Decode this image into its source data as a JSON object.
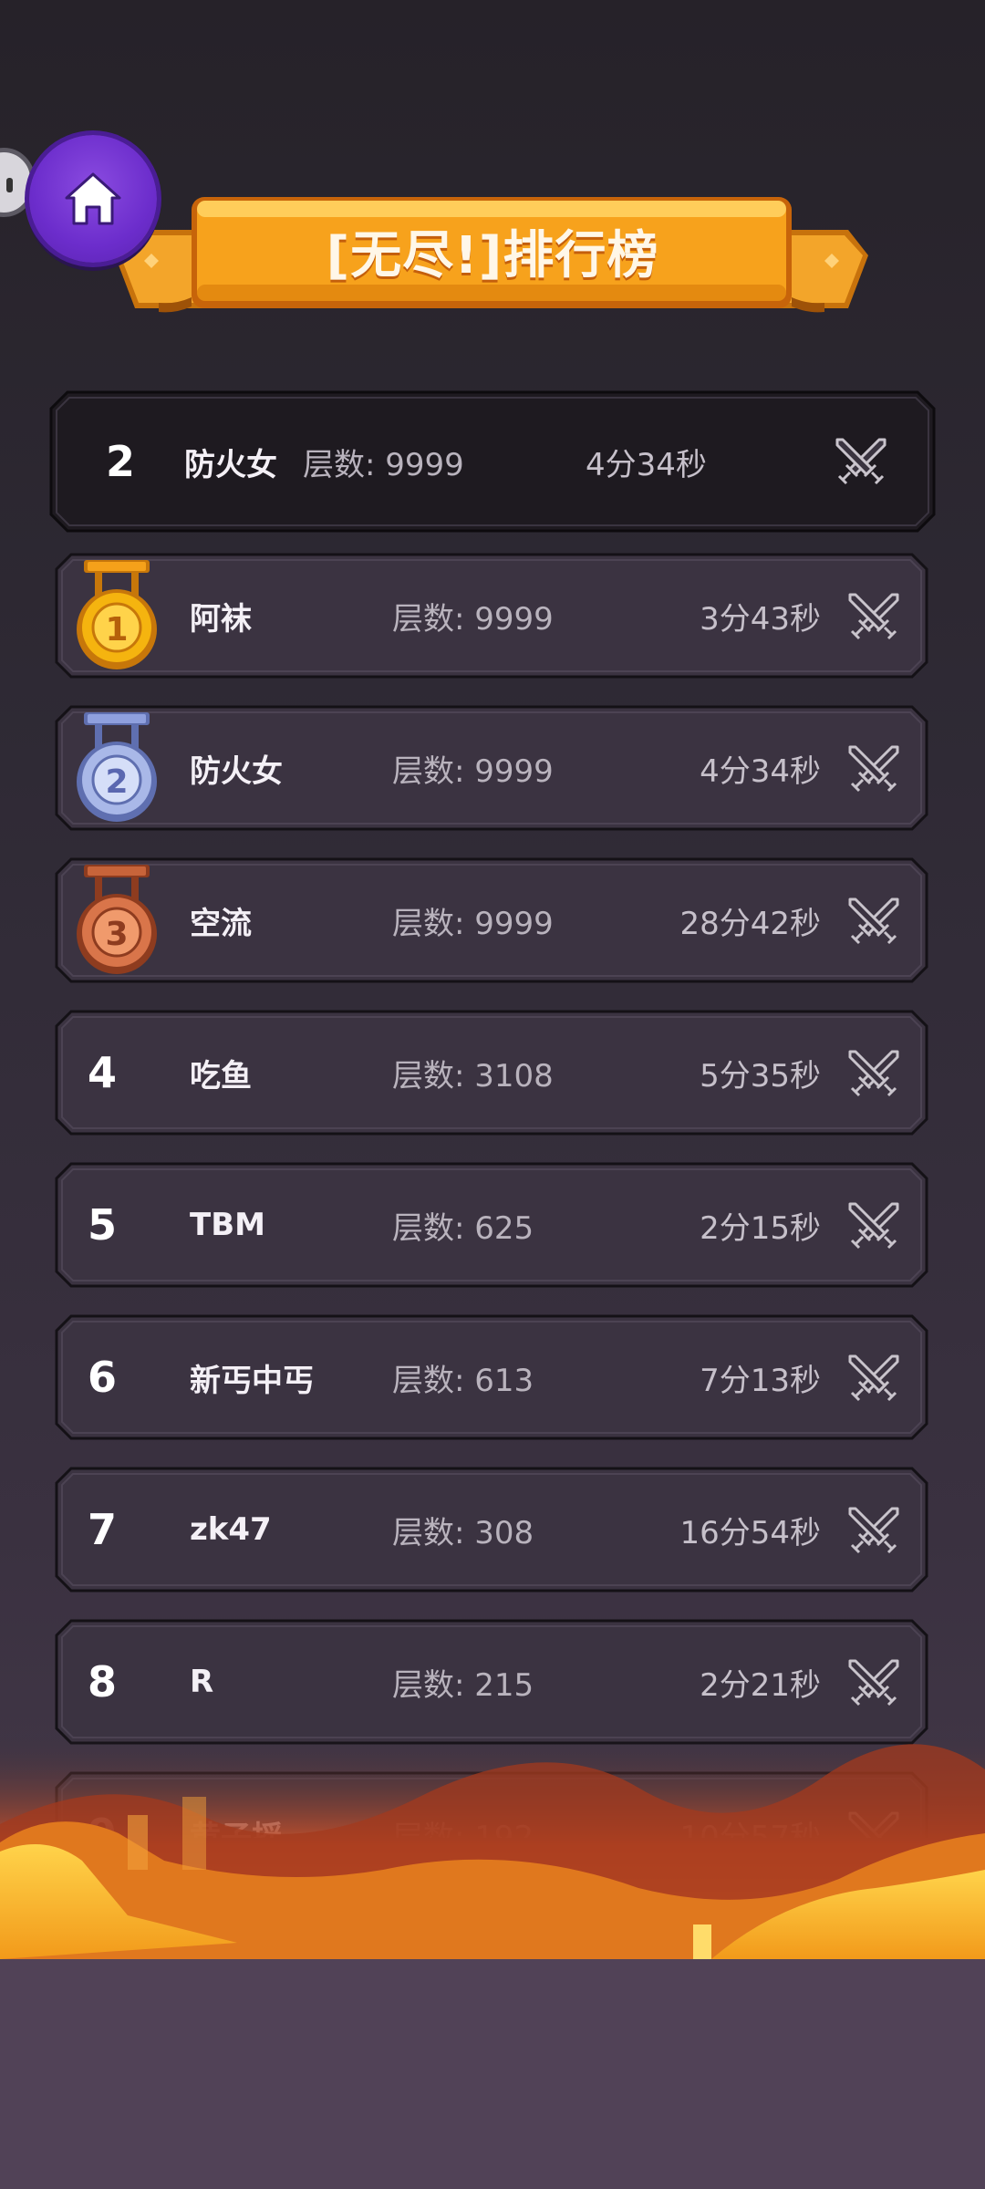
{
  "header": {
    "title": "[无尽!]排行榜",
    "home_icon": "home-icon"
  },
  "my_entry": {
    "rank": "2",
    "name": "防火女",
    "floors": "层数: 9999",
    "time": "4分34秒"
  },
  "leaderboard": [
    {
      "rank": "1",
      "medal": "gold",
      "name": "阿袜",
      "floors": "层数: 9999",
      "time": "3分43秒"
    },
    {
      "rank": "2",
      "medal": "silver",
      "name": "防火女",
      "floors": "层数: 9999",
      "time": "4分34秒"
    },
    {
      "rank": "3",
      "medal": "bronze",
      "name": "空流",
      "floors": "层数: 9999",
      "time": "28分42秒"
    },
    {
      "rank": "4",
      "name": "吃鱼",
      "floors": "层数: 3108",
      "time": "5分35秒"
    },
    {
      "rank": "5",
      "name": "TBM",
      "floors": "层数: 625",
      "time": "2分15秒"
    },
    {
      "rank": "6",
      "name": "新丐中丐",
      "floors": "层数: 613",
      "time": "7分13秒"
    },
    {
      "rank": "7",
      "name": "zk47",
      "floors": "层数: 308",
      "time": "16分54秒"
    },
    {
      "rank": "8",
      "name": "R",
      "floors": "层数: 215",
      "time": "2分21秒"
    },
    {
      "rank": "9",
      "name": "黄子摇",
      "floors": "层数: 192",
      "time": "10分57秒"
    }
  ],
  "colors": {
    "banner": "#f7a21c",
    "home_button": "#6c2dcc",
    "row_bg": "#3a3140",
    "gold": "#f5b40f",
    "silver": "#a9b8e8",
    "bronze": "#d9754a"
  }
}
